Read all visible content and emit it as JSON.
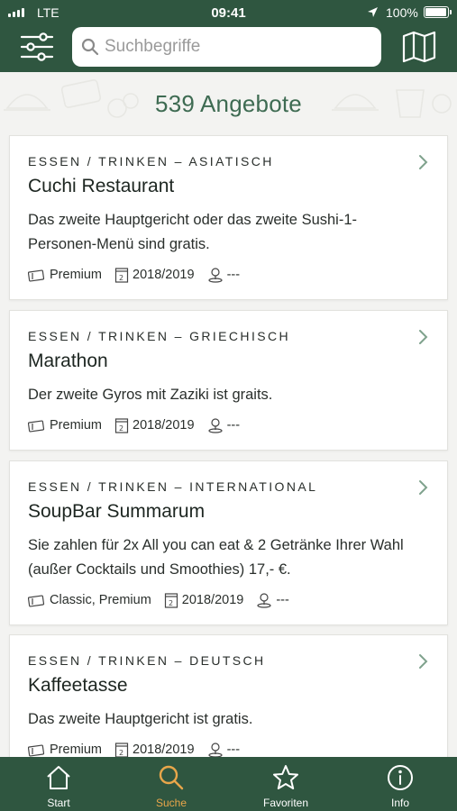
{
  "status_bar": {
    "carrier": "LTE",
    "time": "09:41",
    "battery_percent": "100%",
    "battery_level": 1.0,
    "signal_bars": 4
  },
  "search": {
    "placeholder": "Suchbegriffe",
    "value": ""
  },
  "results": {
    "count_label": "539 Angebote"
  },
  "offers": [
    {
      "category": "ESSEN / TRINKEN – ASIATISCH",
      "name": "Cuchi Restaurant",
      "description": "Das zweite Hauptgericht oder das zweite Sushi-1-Personen-Menü sind gratis.",
      "membership": "Premium",
      "season": "2018/2019",
      "distance": "---"
    },
    {
      "category": "ESSEN / TRINKEN – GRIECHISCH",
      "name": "Marathon",
      "description": "Der zweite Gyros mit Zaziki ist graits.",
      "membership": "Premium",
      "season": "2018/2019",
      "distance": "---"
    },
    {
      "category": "ESSEN / TRINKEN – INTERNATIONAL",
      "name": "SoupBar Summarum",
      "description": "Sie zahlen für 2x All you can eat & 2 Getränke Ihrer Wahl (außer Cocktails und Smoothies) 17,- €.",
      "membership": "Classic, Premium",
      "season": "2018/2019",
      "distance": "---"
    },
    {
      "category": "ESSEN / TRINKEN – DEUTSCH",
      "name": "Kaffeetasse",
      "description": "Das zweite Hauptgericht ist gratis.",
      "membership": "Premium",
      "season": "2018/2019",
      "distance": "---"
    }
  ],
  "tabbar": {
    "items": [
      {
        "label": "Start",
        "icon": "home-icon"
      },
      {
        "label": "Suche",
        "icon": "search-icon",
        "active": true
      },
      {
        "label": "Favoriten",
        "icon": "star-icon"
      },
      {
        "label": "Info",
        "icon": "info-icon"
      }
    ]
  },
  "colors": {
    "header_green": "#2f5640",
    "title_green": "#3e6b52",
    "active_tab": "#e8a64a",
    "background": "#f3f3f1"
  }
}
